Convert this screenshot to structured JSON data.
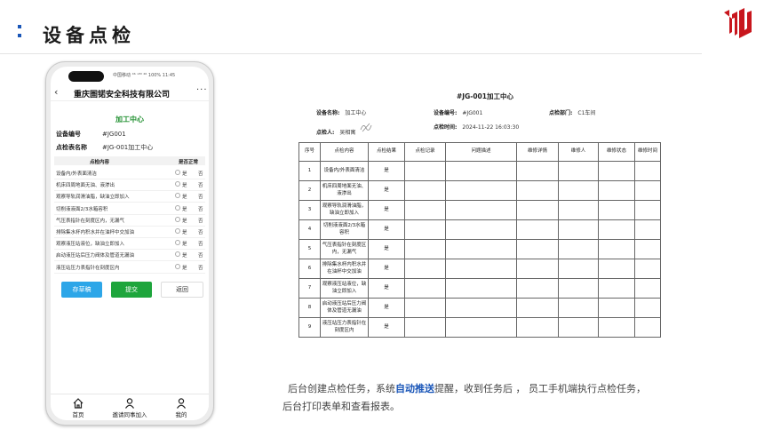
{
  "header": {
    "title": "设备点检"
  },
  "phone": {
    "status_bar": "中国移动 ⁴⁶ ˢᴵᴹ ⁴⁶ 100% 11:45",
    "nav": {
      "back": "‹",
      "title": "重庆圄锘安全科技有限公司",
      "more": "···"
    },
    "form_title": "加工中心",
    "fields": [
      {
        "label": "设备编号",
        "value": "#JG001"
      },
      {
        "label": "点检表名称",
        "value": "#JG-001加工中心"
      }
    ],
    "checklist_header": {
      "content": "点检内容",
      "normal": "是否正常"
    },
    "checklist": [
      "设备内/外表面清洁",
      "机床四周地面无油、液渗出",
      "观察导轨润滑油脂，缺油立即加入",
      "切削液液面2/3水箱容积",
      "气压表指针在刻度区内，无漏气",
      "排除集水杯内积水并在油杯中交加油",
      "观察液压站液位，缺油立即加入",
      "启动液压站后压力阀体及管道无漏油",
      "液压站压力表指针在刻度区内"
    ],
    "option_yes": "是",
    "option_no": "否",
    "buttons": {
      "save": "存草稿",
      "submit": "提交",
      "back": "返回"
    },
    "tabs": [
      {
        "label": "首页",
        "icon": "home-icon"
      },
      {
        "label": "邀请同事加入",
        "icon": "invite-user-icon"
      },
      {
        "label": "我的",
        "icon": "user-icon"
      }
    ]
  },
  "report": {
    "title": "#JG-001加工中心",
    "meta": {
      "device_name_label": "设备名称:",
      "device_name": "加工中心",
      "device_no_label": "设备编号:",
      "device_no": "#JG001",
      "dept_label": "点检部门:",
      "dept": "C1车间",
      "inspector_label": "点检人:",
      "inspector": "吴相寓",
      "time_label": "点检时间:",
      "time": "2024-11-22 16:03:30"
    },
    "columns": [
      "序号",
      "点检内容",
      "点检结果",
      "点检记录",
      "问题描述",
      "维修详情",
      "维修人",
      "维修状态",
      "维修时间"
    ],
    "rows": [
      {
        "no": "1",
        "content": "设备内/外表面清洁",
        "result": "是"
      },
      {
        "no": "2",
        "content": "机床四周地面无油、液渗出",
        "result": "是"
      },
      {
        "no": "3",
        "content": "观察导轨润滑油脂，缺油立即加入",
        "result": "是"
      },
      {
        "no": "4",
        "content": "切削液液面2/3水箱容积",
        "result": "是"
      },
      {
        "no": "5",
        "content": "气压表指针在刻度区内，无漏气",
        "result": "是"
      },
      {
        "no": "6",
        "content": "排除集水杯内积水并在油杯中交加油",
        "result": "是"
      },
      {
        "no": "7",
        "content": "观察液压站液位，缺油立即加入",
        "result": "是"
      },
      {
        "no": "8",
        "content": "启动液压站后压力阀体及管道无漏油",
        "result": "是"
      },
      {
        "no": "9",
        "content": "液压站压力表指针在刻度区内",
        "result": "是"
      }
    ]
  },
  "caption": {
    "part1": "后台创建点检任务，系统",
    "highlight": "自动推送",
    "part2": "提醒，收到任务后 ， 员工手机端执行点检任务，",
    "line2": "后台打印表单和查看报表。"
  },
  "colors": {
    "accent": "#1a56b8",
    "green": "#1ea53c",
    "blue_button": "#2da6e8",
    "logo_red": "#c8161d"
  }
}
